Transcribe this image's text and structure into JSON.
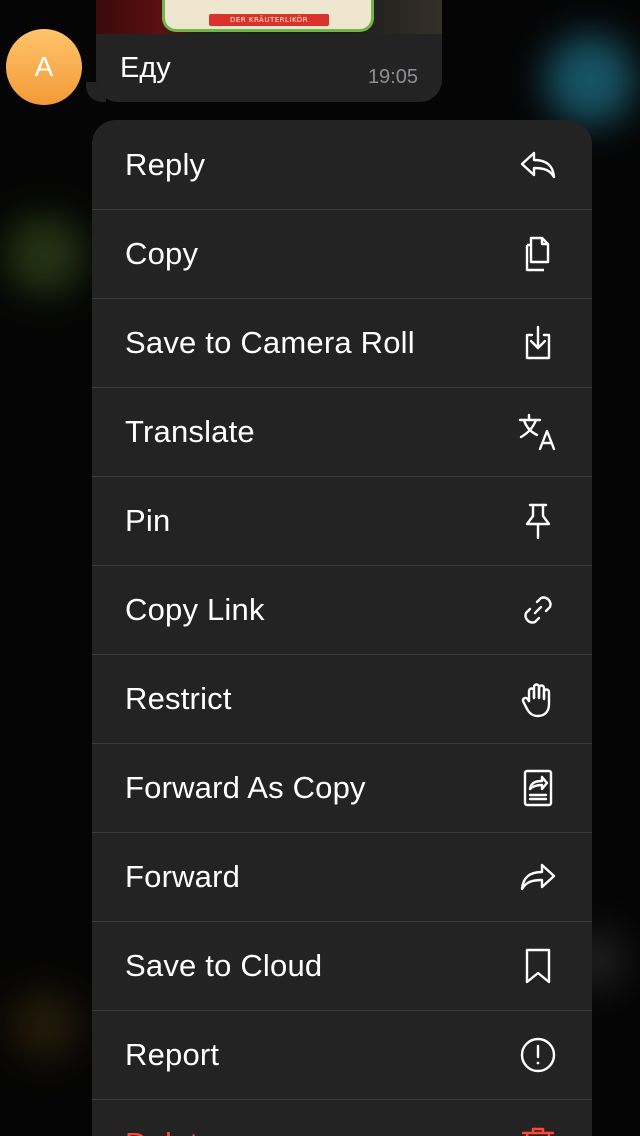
{
  "message": {
    "avatar_letter": "A",
    "text": "Еду",
    "time": "19:05",
    "photo_label_text": "DER KRÄUTERLIKÖR"
  },
  "menu": {
    "items": [
      {
        "label": "Reply",
        "icon": "reply-icon"
      },
      {
        "label": "Copy",
        "icon": "copy-icon"
      },
      {
        "label": "Save to Camera Roll",
        "icon": "save-download-icon"
      },
      {
        "label": "Translate",
        "icon": "translate-icon"
      },
      {
        "label": "Pin",
        "icon": "pin-icon"
      },
      {
        "label": "Copy Link",
        "icon": "link-icon"
      },
      {
        "label": "Restrict",
        "icon": "hand-icon"
      },
      {
        "label": "Forward As Copy",
        "icon": "forward-as-copy-icon"
      },
      {
        "label": "Forward",
        "icon": "forward-icon"
      },
      {
        "label": "Save to Cloud",
        "icon": "bookmark-icon"
      },
      {
        "label": "Report",
        "icon": "report-icon"
      },
      {
        "label": "Delete",
        "icon": "trash-icon"
      }
    ],
    "destructive_color": "#ff453a"
  }
}
